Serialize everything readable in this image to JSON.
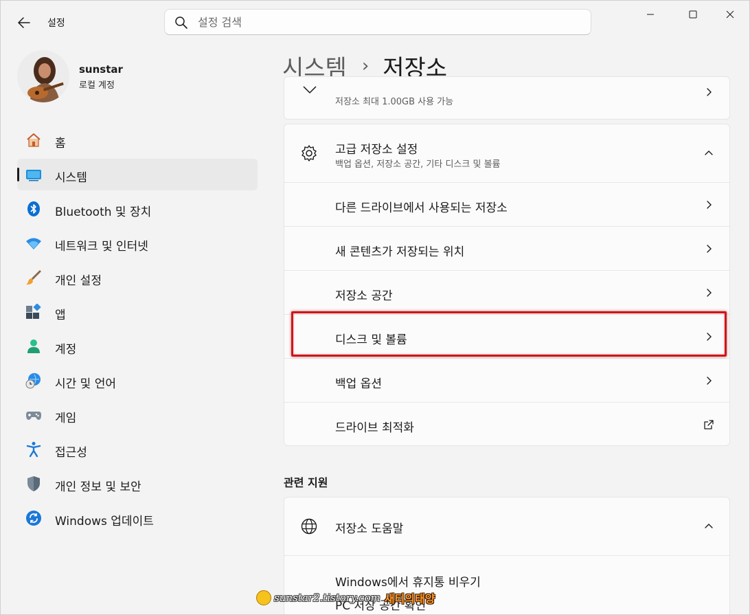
{
  "app": {
    "title": "설정"
  },
  "search": {
    "placeholder": "설정 검색",
    "value": ""
  },
  "profile": {
    "name": "sunstar",
    "type": "로컬 계정"
  },
  "sidebar": {
    "items": [
      {
        "label": "홈",
        "icon": "home-icon"
      },
      {
        "label": "시스템",
        "icon": "system-icon",
        "selected": true
      },
      {
        "label": "Bluetooth 및 장치",
        "icon": "bluetooth-icon"
      },
      {
        "label": "네트워크 및 인터넷",
        "icon": "wifi-icon"
      },
      {
        "label": "개인 설정",
        "icon": "brush-icon"
      },
      {
        "label": "앱",
        "icon": "apps-icon"
      },
      {
        "label": "계정",
        "icon": "account-icon"
      },
      {
        "label": "시간 및 언어",
        "icon": "time-language-icon"
      },
      {
        "label": "게임",
        "icon": "gamepad-icon"
      },
      {
        "label": "접근성",
        "icon": "accessibility-icon"
      },
      {
        "label": "개인 정보 및 보안",
        "icon": "shield-icon"
      },
      {
        "label": "Windows 업데이트",
        "icon": "update-icon"
      }
    ]
  },
  "breadcrumb": {
    "parent": "시스템",
    "separator": "›",
    "current": "저장소"
  },
  "top_card": {
    "subtitle": "저장소 최대 1.00GB 사용 가능"
  },
  "advanced": {
    "title": "고급 저장소 설정",
    "subtitle": "백업 옵션, 저장소 공간, 기타 디스크 및 볼륨",
    "rows": [
      {
        "label": "다른 드라이브에서 사용되는 저장소",
        "action": "chevron"
      },
      {
        "label": "새 콘텐츠가 저장되는 위치",
        "action": "chevron"
      },
      {
        "label": "저장소 공간",
        "action": "chevron"
      },
      {
        "label": "디스크 및 볼륨",
        "action": "chevron",
        "highlighted": true
      },
      {
        "label": "백업 옵션",
        "action": "chevron"
      },
      {
        "label": "드라이브 최적화",
        "action": "external"
      }
    ]
  },
  "related": {
    "title": "관련 지원",
    "help": {
      "title": "저장소 도움말",
      "links": [
        "Windows에서 휴지통 비우기",
        "PC 저장 공간 확인"
      ]
    }
  },
  "watermark": {
    "url": "sunstar2.tistory.com",
    "name": "새티의태양"
  },
  "colors": {
    "accent": "#0067c0",
    "highlight_border": "#d0141a",
    "background": "#f3f3f3",
    "card": "#fbfbfb"
  }
}
